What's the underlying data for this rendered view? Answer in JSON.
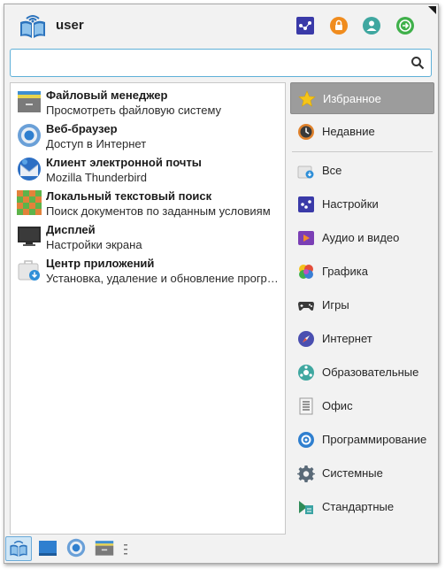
{
  "header": {
    "user_name": "user",
    "buttons": [
      {
        "name": "settings",
        "icon": "settings-icon",
        "color": "#3a3aa8"
      },
      {
        "name": "lock",
        "icon": "lock-icon",
        "color": "#f08c1e"
      },
      {
        "name": "user",
        "icon": "user-icon",
        "color": "#3fa7a0"
      },
      {
        "name": "logout",
        "icon": "logout-icon",
        "color": "#3fb04a"
      }
    ]
  },
  "search": {
    "value": "",
    "placeholder": ""
  },
  "apps": [
    {
      "name": "Файловый менеджер",
      "desc": "Просмотреть файловую систему",
      "icon": "file-manager-icon"
    },
    {
      "name": "Веб-браузер",
      "desc": "Доступ в Интернет",
      "icon": "web-browser-icon"
    },
    {
      "name": "Клиент электронной почты",
      "desc": "Mozilla Thunderbird",
      "icon": "thunderbird-icon"
    },
    {
      "name": "Локальный текстовый поиск",
      "desc": "Поиск документов по заданным условиям",
      "icon": "text-search-icon"
    },
    {
      "name": "Дисплей",
      "desc": "Настройки экрана",
      "icon": "display-icon"
    },
    {
      "name": "Центр приложений",
      "desc": "Установка, удаление и обновление программ",
      "icon": "app-center-icon"
    }
  ],
  "categories": [
    {
      "label": "Избранное",
      "icon": "star-icon",
      "selected": true
    },
    {
      "label": "Недавние",
      "icon": "recent-icon"
    },
    {
      "label": "Все",
      "icon": "all-apps-icon"
    },
    {
      "label": "Настройки",
      "icon": "settings-icon"
    },
    {
      "label": "Аудио и видео",
      "icon": "multimedia-icon"
    },
    {
      "label": "Графика",
      "icon": "graphics-icon"
    },
    {
      "label": "Игры",
      "icon": "gamepad-icon"
    },
    {
      "label": "Интернет",
      "icon": "internet-icon"
    },
    {
      "label": "Образовательные",
      "icon": "education-icon"
    },
    {
      "label": "Офис",
      "icon": "office-icon"
    },
    {
      "label": "Программирование",
      "icon": "development-icon"
    },
    {
      "label": "Системные",
      "icon": "system-gear-icon"
    },
    {
      "label": "Стандартные",
      "icon": "accessories-icon"
    }
  ],
  "taskbar": [
    {
      "name": "menu",
      "icon": "app-menu-icon",
      "active": true
    },
    {
      "name": "desktop",
      "icon": "show-desktop-icon"
    },
    {
      "name": "browser",
      "icon": "web-browser-icon"
    },
    {
      "name": "files",
      "icon": "file-manager-icon"
    }
  ],
  "colors": {
    "accent": "#5fb0d8",
    "selected_bg": "#9c9c9c"
  }
}
